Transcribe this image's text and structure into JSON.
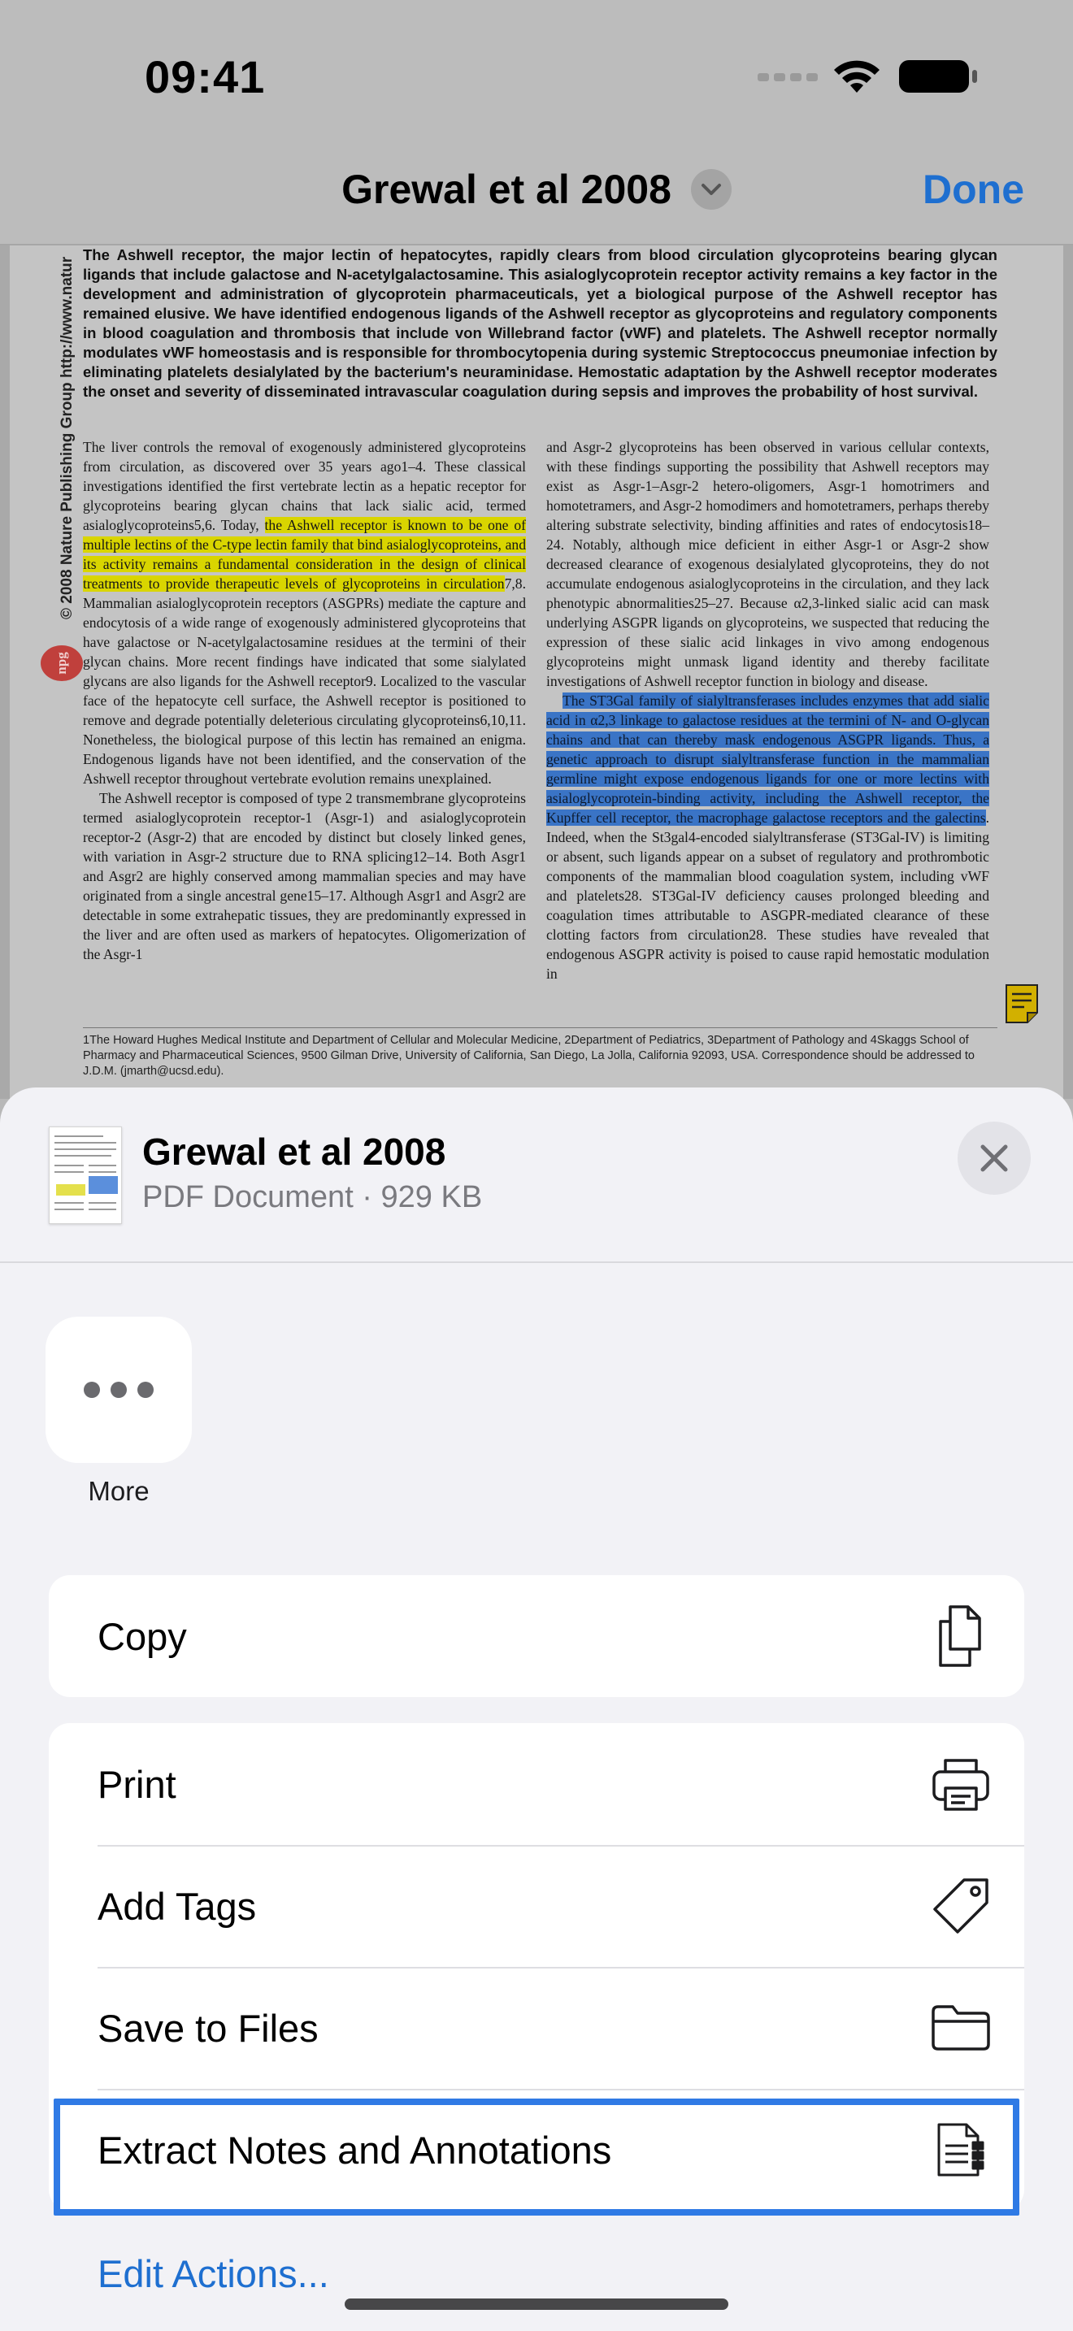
{
  "status_bar": {
    "time": "09:41"
  },
  "nav": {
    "title": "Grewal et al 2008",
    "done_label": "Done"
  },
  "document": {
    "side_text": "© 2008 Nature Publishing Group  http://www.natur",
    "logo_text": "npg",
    "abstract": "The Ashwell receptor, the major lectin of hepatocytes, rapidly clears from blood circulation glycoproteins bearing glycan ligands that include galactose and N-acetylgalactosamine. This asialoglycoprotein receptor activity remains a key factor in the development and administration of glycoprotein pharmaceuticals, yet a biological purpose of the Ashwell receptor has remained elusive. We have identified endogenous ligands of the Ashwell receptor as glycoproteins and regulatory components in blood coagulation and thrombosis that include von Willebrand factor (vWF) and platelets. The Ashwell receptor normally modulates vWF homeostasis and is responsible for thrombocytopenia during systemic Streptococcus pneumoniae infection by eliminating platelets desialylated by the bacterium's neuraminidase. Hemostatic adaptation by the Ashwell receptor moderates the onset and severity of disseminated intravascular coagulation during sepsis and improves the probability of host survival.",
    "left_p1_a": "The liver controls the removal of exogenously administered glycoproteins from circulation, as discovered over 35 years ago1–4. These classical investigations identified the first vertebrate lectin as a hepatic receptor for glycoproteins bearing glycan chains that lack sialic acid, termed asialoglycoproteins5,6. Today, ",
    "left_p1_hl": "the Ashwell receptor is known to be one of multiple lectins of the C-type lectin family that bind asialoglycoproteins, and its activity remains a fundamental consideration in the design of clinical treatments to provide therapeutic levels of glycoproteins in circulation",
    "left_p1_b": "7,8. Mammalian asialoglycoprotein receptors (ASGPRs) mediate the capture and endocytosis of a wide range of exogenously administered glycoproteins that have galactose or N-acetylgalactosamine residues at the termini of their glycan chains. More recent findings have indicated that some sialylated glycans are also ligands for the Ashwell receptor9. Localized to the vascular face of the hepatocyte cell surface, the Ashwell receptor is positioned to remove and degrade potentially deleterious circulating glycoproteins6,10,11. Nonetheless, the biological purpose of this lectin has remained an enigma. Endogenous ligands have not been identified, and the conservation of the Ashwell receptor throughout vertebrate evolution remains unexplained.",
    "left_p2": "The Ashwell receptor is composed of type 2 transmembrane glycoproteins termed asialoglycoprotein receptor-1 (Asgr-1) and asialoglycoprotein receptor-2 (Asgr-2) that are encoded by distinct but closely linked genes, with variation in Asgr-2 structure due to RNA splicing12–14. Both Asgr1 and Asgr2 are highly conserved among mammalian species and may have originated from a single ancestral gene15–17. Although Asgr1 and Asgr2 are detectable in some extrahepatic tissues, they are predominantly expressed in the liver and are often used as markers of hepatocytes. Oligomerization of the Asgr-1",
    "right_p1": "and Asgr-2 glycoproteins has been observed in various cellular contexts, with these findings supporting the possibility that Ashwell receptors may exist as Asgr-1–Asgr-2 hetero-oligomers, Asgr-1 homotrimers and homotetramers, and Asgr-2 homodimers and homotetramers, perhaps thereby altering substrate selectivity, binding affinities and rates of endocytosis18–24. Notably, although mice deficient in either Asgr-1 or Asgr-2 show decreased clearance of exogenous desialylated glycoproteins, they do not accumulate endogenous asialoglycoproteins in the circulation, and they lack phenotypic abnormalities25–27. Because α2,3-linked sialic acid can mask underlying ASGPR ligands on glycoproteins, we suspected that reducing the expression of these sialic acid linkages in vivo among endogenous glycoproteins might unmask ligand identity and thereby facilitate investigations of Ashwell receptor function in biology and disease.",
    "right_p2_hl": "The ST3Gal family of sialyltransferases includes enzymes that add sialic acid in α2,3 linkage to galactose residues at the termini of N- and O-glycan chains and that can thereby mask endogenous ASGPR ligands. Thus, a genetic approach to disrupt sialyltransferase function in the mammalian germline might expose endogenous ligands for one or more lectins with asialoglycoprotein-binding activity, including the Ashwell receptor, the Kupffer cell receptor, the macrophage galactose receptors and the galectins",
    "right_p2_b": ". Indeed, when the St3gal4-encoded sialyltransferase (ST3Gal-IV) is limiting or absent, such ligands appear on a subset of regulatory and prothrombotic components of the mammalian blood coagulation system, including vWF and platelets28. ST3Gal-IV deficiency causes prolonged bleeding and coagulation times attributable to ASGPR-mediated clearance of these clotting factors from circulation28. These studies have revealed that endogenous ASGPR activity is poised to cause rapid hemostatic modulation in",
    "affiliations": "1The Howard Hughes Medical Institute and Department of Cellular and Molecular Medicine, 2Department of Pediatrics, 3Department of Pathology and 4Skaggs School of Pharmacy and Pharmaceutical Sciences, 9500 Gilman Drive, University of California, San Diego, La Jolla, California 92093, USA. Correspondence should be addressed to J.D.M. (jmarth@ucsd.edu)."
  },
  "share_sheet": {
    "file_name": "Grewal et al 2008",
    "file_meta": "PDF Document · 929 KB",
    "more_label": "More",
    "actions_group1": [
      {
        "label": "Copy",
        "icon": "copy-icon"
      }
    ],
    "actions_group2": [
      {
        "label": "Print",
        "icon": "printer-icon"
      },
      {
        "label": "Add Tags",
        "icon": "tag-icon"
      },
      {
        "label": "Save to Files",
        "icon": "folder-icon"
      },
      {
        "label": "Extract Notes and Annotations",
        "icon": "document-list-icon"
      }
    ],
    "edit_actions_label": "Edit Actions..."
  },
  "colors": {
    "accent": "#1e6fd0",
    "highlight_border": "#2f7ae5",
    "yellow_highlight": "#d9d500",
    "blue_highlight": "#3a74c6"
  }
}
